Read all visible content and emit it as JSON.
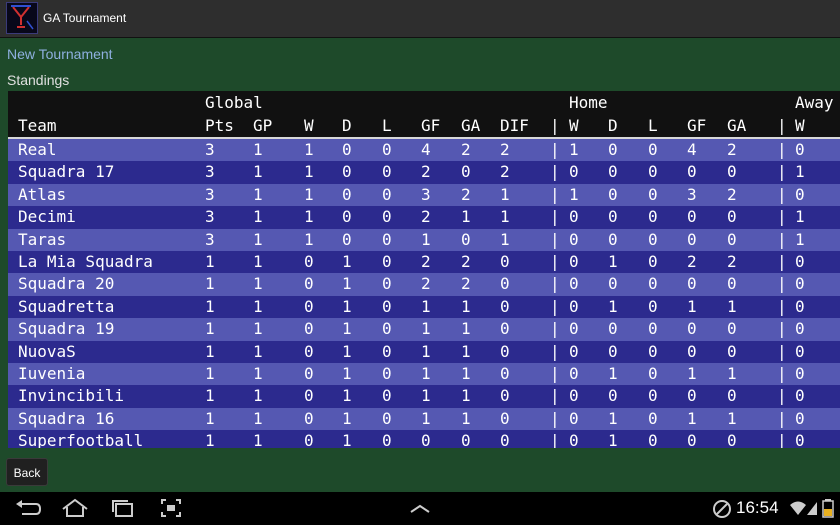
{
  "app": {
    "title": "GA Tournament",
    "icon": "trophy-logo-icon"
  },
  "actions": {
    "new_tournament": "New Tournament",
    "back": "Back"
  },
  "standings_label": "Standings",
  "table": {
    "groups": {
      "global": "Global",
      "home": "Home",
      "away": "Away"
    },
    "headers": [
      "Team",
      "Pts",
      "GP",
      "W",
      "D",
      "L",
      "GF",
      "GA",
      "DIF",
      "|",
      "W",
      "D",
      "L",
      "GF",
      "GA",
      "|",
      "W"
    ],
    "rows": [
      [
        "Real",
        "3",
        "1",
        "1",
        "0",
        "0",
        "4",
        "2",
        "2",
        "|",
        "1",
        "0",
        "0",
        "4",
        "2",
        "|",
        "0"
      ],
      [
        "Squadra 17",
        "3",
        "1",
        "1",
        "0",
        "0",
        "2",
        "0",
        "2",
        "|",
        "0",
        "0",
        "0",
        "0",
        "0",
        "|",
        "1"
      ],
      [
        "Atlas",
        "3",
        "1",
        "1",
        "0",
        "0",
        "3",
        "2",
        "1",
        "|",
        "1",
        "0",
        "0",
        "3",
        "2",
        "|",
        "0"
      ],
      [
        "Decimi",
        "3",
        "1",
        "1",
        "0",
        "0",
        "2",
        "1",
        "1",
        "|",
        "0",
        "0",
        "0",
        "0",
        "0",
        "|",
        "1"
      ],
      [
        "Taras",
        "3",
        "1",
        "1",
        "0",
        "0",
        "1",
        "0",
        "1",
        "|",
        "0",
        "0",
        "0",
        "0",
        "0",
        "|",
        "1"
      ],
      [
        "La Mia Squadra",
        "1",
        "1",
        "0",
        "1",
        "0",
        "2",
        "2",
        "0",
        "|",
        "0",
        "1",
        "0",
        "2",
        "2",
        "|",
        "0"
      ],
      [
        "Squadra 20",
        "1",
        "1",
        "0",
        "1",
        "0",
        "2",
        "2",
        "0",
        "|",
        "0",
        "0",
        "0",
        "0",
        "0",
        "|",
        "0"
      ],
      [
        "Squadretta",
        "1",
        "1",
        "0",
        "1",
        "0",
        "1",
        "1",
        "0",
        "|",
        "0",
        "1",
        "0",
        "1",
        "1",
        "|",
        "0"
      ],
      [
        "Squadra 19",
        "1",
        "1",
        "0",
        "1",
        "0",
        "1",
        "1",
        "0",
        "|",
        "0",
        "0",
        "0",
        "0",
        "0",
        "|",
        "0"
      ],
      [
        "NuovaS",
        "1",
        "1",
        "0",
        "1",
        "0",
        "1",
        "1",
        "0",
        "|",
        "0",
        "0",
        "0",
        "0",
        "0",
        "|",
        "0"
      ],
      [
        "Iuvenia",
        "1",
        "1",
        "0",
        "1",
        "0",
        "1",
        "1",
        "0",
        "|",
        "0",
        "1",
        "0",
        "1",
        "1",
        "|",
        "0"
      ],
      [
        "Invincibili",
        "1",
        "1",
        "0",
        "1",
        "0",
        "1",
        "1",
        "0",
        "|",
        "0",
        "0",
        "0",
        "0",
        "0",
        "|",
        "0"
      ],
      [
        "Squadra 16",
        "1",
        "1",
        "0",
        "1",
        "0",
        "1",
        "1",
        "0",
        "|",
        "0",
        "1",
        "0",
        "1",
        "1",
        "|",
        "0"
      ],
      [
        "Superfootball",
        "1",
        "1",
        "0",
        "1",
        "0",
        "0",
        "0",
        "0",
        "|",
        "0",
        "1",
        "0",
        "0",
        "0",
        "|",
        "0"
      ]
    ]
  },
  "status": {
    "time": "16:54"
  },
  "nav": {
    "icons": [
      "back-arrow-icon",
      "home-icon",
      "recent-apps-icon",
      "screenshot-icon",
      "chevron-up-icon"
    ]
  },
  "colors": {
    "background": "#1e4a2a",
    "row_odd": "#5558b2",
    "row_even": "#2c2a8e",
    "link": "#8fb0e0"
  }
}
